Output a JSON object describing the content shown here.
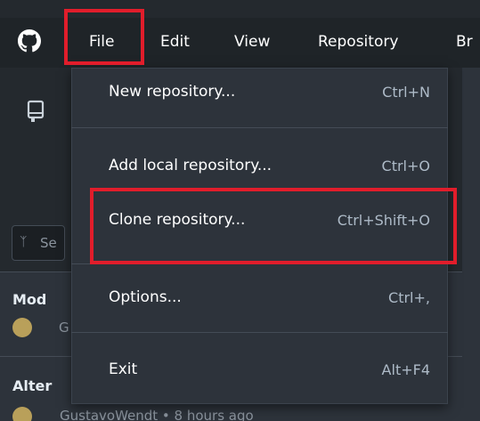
{
  "menubar": {
    "file": "File",
    "edit": "Edit",
    "view": "View",
    "repository": "Repository",
    "branch": "Br"
  },
  "filter": {
    "placeholder_partial": "Se"
  },
  "history": {
    "rows": [
      {
        "title": "Mod",
        "author_partial": "G"
      },
      {
        "title": "Alter",
        "meta": "GustavoWendt • 8 hours ago"
      }
    ]
  },
  "file_menu": {
    "items": [
      {
        "label": "New repository...",
        "shortcut": "Ctrl+N"
      },
      {
        "label": "Add local repository...",
        "shortcut": "Ctrl+O"
      },
      {
        "label": "Clone repository...",
        "shortcut": "Ctrl+Shift+O"
      },
      {
        "label": "Options...",
        "shortcut": "Ctrl+,"
      },
      {
        "label": "Exit",
        "shortcut": "Alt+F4"
      }
    ]
  },
  "colors": {
    "titlebar": "#1f2428",
    "menu_bg": "#2d333b",
    "highlight_box": "#e11d2b"
  },
  "icons": {
    "app_logo": "github-octocat-icon",
    "repo": "repository-icon",
    "filter": "branch-filter-icon"
  }
}
